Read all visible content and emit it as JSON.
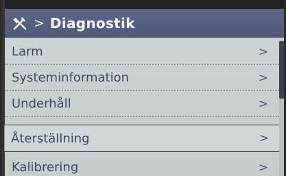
{
  "header": {
    "icon": "wrench-screwdriver-icon",
    "separator": ">",
    "title": "Diagnostik"
  },
  "menu": {
    "items": [
      {
        "label": "Larm",
        "chevron": ">"
      },
      {
        "label": "Systeminformation",
        "chevron": ">"
      },
      {
        "label": "Underhåll",
        "chevron": ">"
      },
      {
        "label": "Återställning",
        "chevron": ">",
        "selected": true
      },
      {
        "label": "Kalibrering",
        "chevron": ">"
      }
    ]
  },
  "colors": {
    "header_bg": "#5b6686",
    "screen_bg": "#cfd4d5",
    "text": "#3d4a63",
    "scroll_thumb": "#3a4052"
  }
}
